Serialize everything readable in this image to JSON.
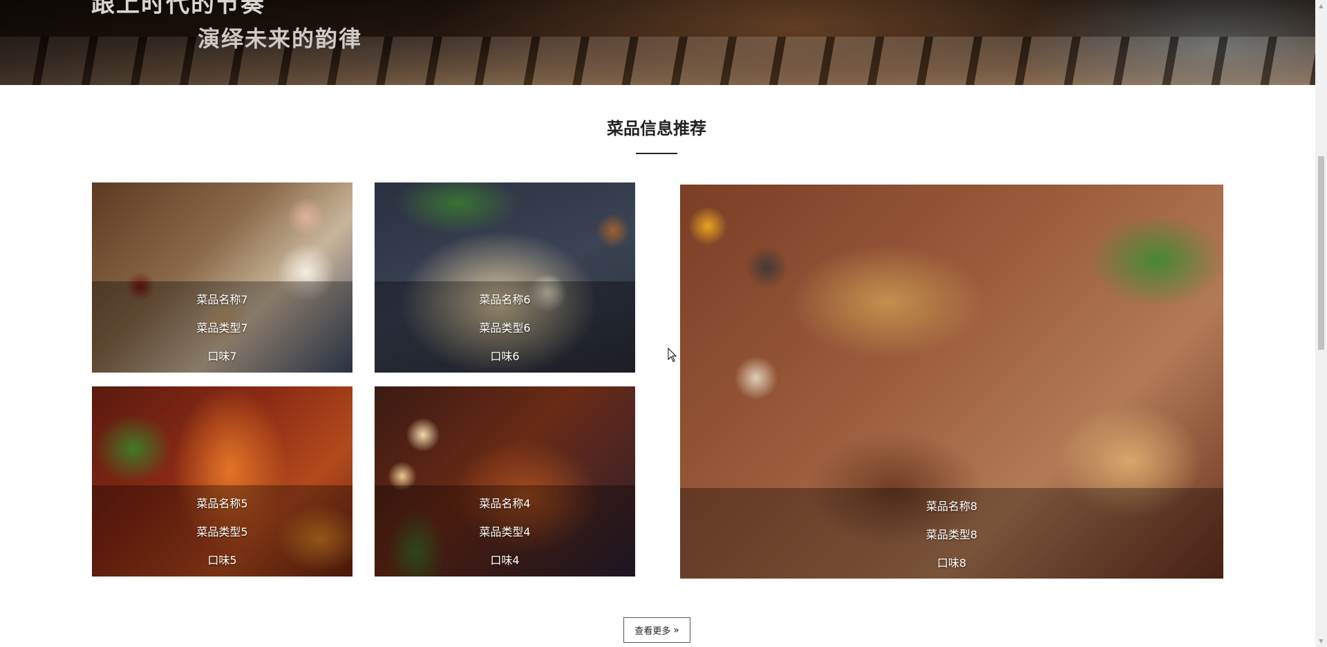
{
  "hero": {
    "line1": "跟上时代的节奏",
    "line2": "演绎未来的韵律"
  },
  "section": {
    "title": "菜品信息推荐"
  },
  "cards": [
    {
      "name": "菜品名称7",
      "type": "菜品类型7",
      "taste": "口味7"
    },
    {
      "name": "菜品名称6",
      "type": "菜品类型6",
      "taste": "口味6"
    },
    {
      "name": "菜品名称5",
      "type": "菜品类型5",
      "taste": "口味5"
    },
    {
      "name": "菜品名称4",
      "type": "菜品类型4",
      "taste": "口味4"
    },
    {
      "name": "菜品名称8",
      "type": "菜品类型8",
      "taste": "口味8"
    }
  ],
  "more_button": {
    "label": "查看更多",
    "icon": "double-chevron-right-icon"
  },
  "colors": {
    "title_text": "#222222",
    "overlay": "rgba(0,0,0,0.32)",
    "card_text": "#ffffff"
  }
}
